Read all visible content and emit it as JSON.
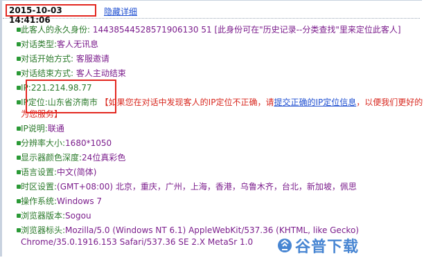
{
  "header": {
    "timestamp": "2015-10-03 14:41:06",
    "hide_details": "隐藏详细"
  },
  "items": [
    {
      "label": "此客人的永久身份: ",
      "value": "14438544528571906130 51 [此身份可在\"历史记录--分类查找\"里来定位此客人]"
    },
    {
      "label": "对话类型:",
      "value": "客人无讯息"
    },
    {
      "label": "对话开始方式: ",
      "value": "客服邀请"
    },
    {
      "label": "对话结束方式: ",
      "value": "客人主动结束"
    },
    {
      "label": "IP:",
      "value": "221.214.98.77"
    },
    {
      "label": "IP定位:",
      "value": "山东省济南市",
      "note_start": "【如果您在对话中发现客人的IP定位不正确，请",
      "link": "提交正确的IP定位信息",
      "note_end": "，以便我们更好的为您服务】"
    },
    {
      "label": "IP说明:",
      "value": "联通"
    },
    {
      "label": "分辨率大小:",
      "value": "1680*1050"
    },
    {
      "label": "显示器颜色深度:",
      "value": "24位真彩色"
    },
    {
      "label": "语言设置:",
      "value": "中文(简体)"
    },
    {
      "label": "时区设置:",
      "value": "(GMT+08:00) 北京，重庆，广州，上海，香港，乌鲁木齐，台北，新加坡，佩思"
    },
    {
      "label": "操作系统:",
      "value": "Windows 7"
    },
    {
      "label": "浏览器版本:",
      "value": "Sogou"
    },
    {
      "label": "浏览器标头:",
      "value": "Mozilla/5.0 (Windows NT 6.1) AppleWebKit/537.36 (KHTML, like Gecko)",
      "value_line2": "Chrome/35.0.1916.153 Safari/537.36 SE 2.X MetaSr 1.0"
    }
  ],
  "watermark": {
    "text": "谷普下载",
    "icon": "gupu-logo-icon"
  },
  "colors": {
    "label_green": "#2b7a2b",
    "value_purple": "#7b1d8c",
    "highlight_red": "#e3261f",
    "link_blue": "#1f4fd1",
    "bullet_green": "#2a9a36"
  }
}
